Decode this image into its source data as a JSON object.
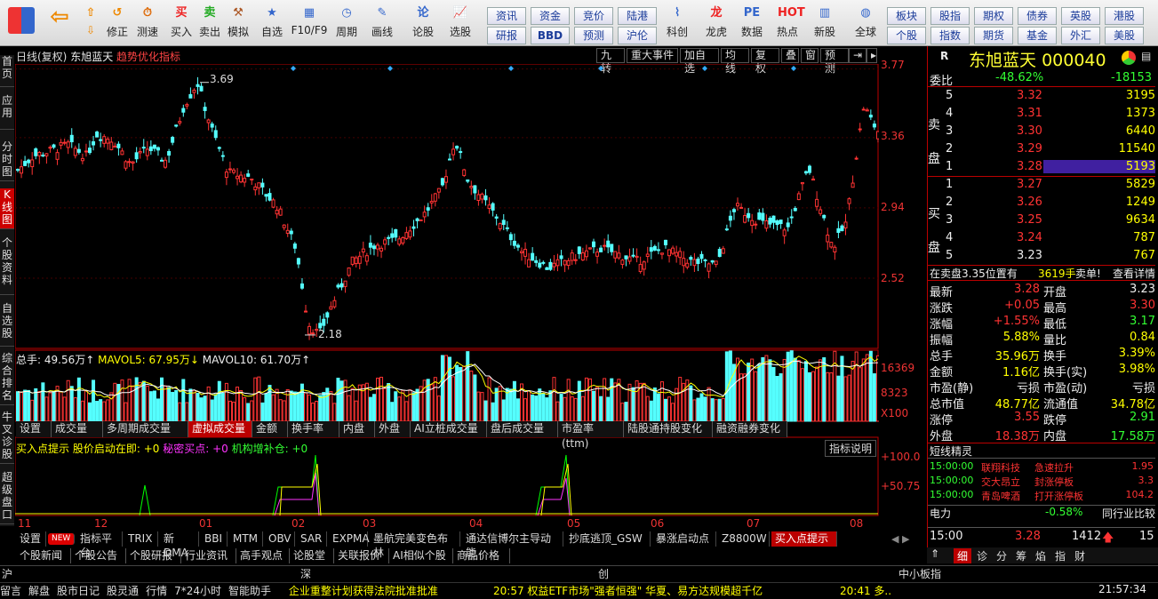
{
  "toolbar": {
    "buttons": [
      "修正",
      "测速",
      "买入",
      "卖出",
      "模拟",
      "自选",
      "F10/F9",
      "周期",
      "画线",
      "论股",
      "选股",
      "科创",
      "龙虎",
      "数据",
      "热点",
      "新股",
      "全球"
    ],
    "grid": [
      [
        "资讯",
        "资金",
        "竞价",
        "陆港"
      ],
      [
        "研报",
        "BBD",
        "预测",
        "沪伦"
      ]
    ],
    "grid2": [
      [
        "板块",
        "股指",
        "期权",
        "债券",
        "英股",
        "港股"
      ],
      [
        "个股",
        "指数",
        "期货",
        "基金",
        "外汇",
        "美股"
      ]
    ]
  },
  "side_tabs": [
    "首页",
    "应用",
    "分时图",
    "K线图",
    "个股资料",
    "自选股",
    "综合排名",
    "牛叉诊股",
    "超级盘口"
  ],
  "chart_header": {
    "period": "日线(复权)",
    "name": "东旭蓝天",
    "indicator": "趋势优化指标"
  },
  "top_buttons": [
    "九转",
    "重大事件",
    "加自选",
    "均线",
    "复权",
    "叠",
    "窗",
    "预测"
  ],
  "price_axis": [
    "3.77",
    "3.36",
    "2.94",
    "2.52"
  ],
  "price_marks": {
    "high": "3.69",
    "low": "2.18"
  },
  "vol_header": {
    "total": "总手: 49.56万↑",
    "ma5": "MAVOL5: 67.95万↓",
    "ma10": "MAVOL10: 61.70万↑"
  },
  "vol_axis": [
    "16369",
    "8323",
    "X100"
  ],
  "sub_tabs": [
    "设置",
    "成交量",
    "多周期成交量",
    "虚拟成交量",
    "金额",
    "换手率",
    "内盘",
    "外盘",
    "AI立桩成交量",
    "盘后成交量",
    "市盈率(ttm)",
    "陆股通持股变化",
    "融资融券变化"
  ],
  "ind_header": {
    "name": "买入点提示",
    "a": "股价启动在即: +0",
    "b": "秘密买点: +0",
    "c": "机构增补仓: +0",
    "btn": "指标说明"
  },
  "ind_axis": [
    "+100.0",
    "+50.75"
  ],
  "months": [
    "11",
    "12",
    "01",
    "02",
    "03",
    "04",
    "05",
    "06",
    "07",
    "08"
  ],
  "bottom_tabs": [
    "设置",
    "NEW",
    "指标平台",
    "TRIX",
    "新DMA",
    "BBI",
    "MTM",
    "OBV",
    "SAR",
    "EXPMA",
    "墨航完美变色布林",
    "通达信博尔主导动能",
    "抄底逃顶_GSW",
    "暴涨启动点",
    "Z8800W",
    "买入点提示"
  ],
  "bottom_tabs2": [
    "个股新闻",
    "个股公告",
    "个股研报",
    "行业资讯",
    "高手观点",
    "论股堂",
    "关联报价",
    "AI相似个股",
    "商品价格"
  ],
  "market_bar": [
    "沪",
    "深",
    "创",
    "中小板指"
  ],
  "ticker": {
    "items": [
      "留言",
      "解盘",
      "股市日记",
      "股灵通",
      "行情",
      "7*24小时",
      "智能助手"
    ],
    "news1": "企业重整计划获得法院批准批准",
    "news2": "20:57 权益ETF市场\"强者恒强\" 华夏、易方达规模超千亿",
    "news3": "20:41 多..",
    "clock": "21:57:34"
  },
  "quote": {
    "code": "R",
    "name": "东旭蓝天",
    "symbol": "000040",
    "wb_label": "委比",
    "wb": "-48.62%",
    "wc": "-18153",
    "sell_label": "卖盘",
    "buy_label": "买盘",
    "asks": [
      [
        "5",
        "3.32",
        "3195"
      ],
      [
        "4",
        "3.31",
        "1373"
      ],
      [
        "3",
        "3.30",
        "6440"
      ],
      [
        "2",
        "3.29",
        "11540"
      ],
      [
        "1",
        "3.28",
        "5193"
      ]
    ],
    "bids": [
      [
        "1",
        "3.27",
        "5829"
      ],
      [
        "2",
        "3.26",
        "1249"
      ],
      [
        "3",
        "3.25",
        "9634"
      ],
      [
        "4",
        "3.24",
        "787"
      ],
      [
        "5",
        "3.23",
        "767"
      ]
    ],
    "note": "在卖盘3.35位置有",
    "note_v": "3619手",
    "note_t": "卖单!",
    "note_btn": "查看详情",
    "stats": [
      [
        "最新",
        "3.28",
        "开盘",
        "3.23"
      ],
      [
        "涨跌",
        "+0.05",
        "最高",
        "3.30"
      ],
      [
        "涨幅",
        "+1.55%",
        "最低",
        "3.17"
      ],
      [
        "振幅",
        "5.88%",
        "量比",
        "0.84"
      ],
      [
        "总手",
        "35.96万",
        "换手",
        "3.39%"
      ],
      [
        "金额",
        "1.16亿",
        "换手(实)",
        "3.98%"
      ],
      [
        "市盈(静)",
        "亏损",
        "市盈(动)",
        "亏损"
      ],
      [
        "总市值",
        "48.77亿",
        "流通值",
        "34.78亿"
      ],
      [
        "涨停",
        "3.55",
        "跌停",
        "2.91"
      ],
      [
        "外盘",
        "18.38万",
        "内盘",
        "17.58万"
      ]
    ],
    "elite_title": "短线精灵",
    "elite": [
      [
        "15:00:00",
        "联翔科技",
        "急速拉升",
        "1.95"
      ],
      [
        "15:00:00",
        "交大昂立",
        "封涨停板",
        "3.3"
      ],
      [
        "15:00:00",
        "青岛啤酒",
        "打开涨停板",
        "104.2"
      ]
    ],
    "power": "电力",
    "power_pct": "-0.58%",
    "power_btn": "同行业比较",
    "last_time": "15:00",
    "last_price": "3.28",
    "last_vol": "1412",
    "last_n": "15",
    "tabs": [
      "细",
      "诊",
      "分",
      "筹",
      "焰",
      "指",
      "财"
    ]
  },
  "chart_data": {
    "type": "candlestick",
    "x_ticks": [
      "11",
      "12",
      "01",
      "02",
      "03",
      "04",
      "05",
      "06",
      "07",
      "08"
    ],
    "ylim": [
      2.1,
      3.8
    ],
    "y_ticks": [
      3.77,
      3.36,
      2.94,
      2.52
    ],
    "high": 3.69,
    "low": 2.18
  }
}
